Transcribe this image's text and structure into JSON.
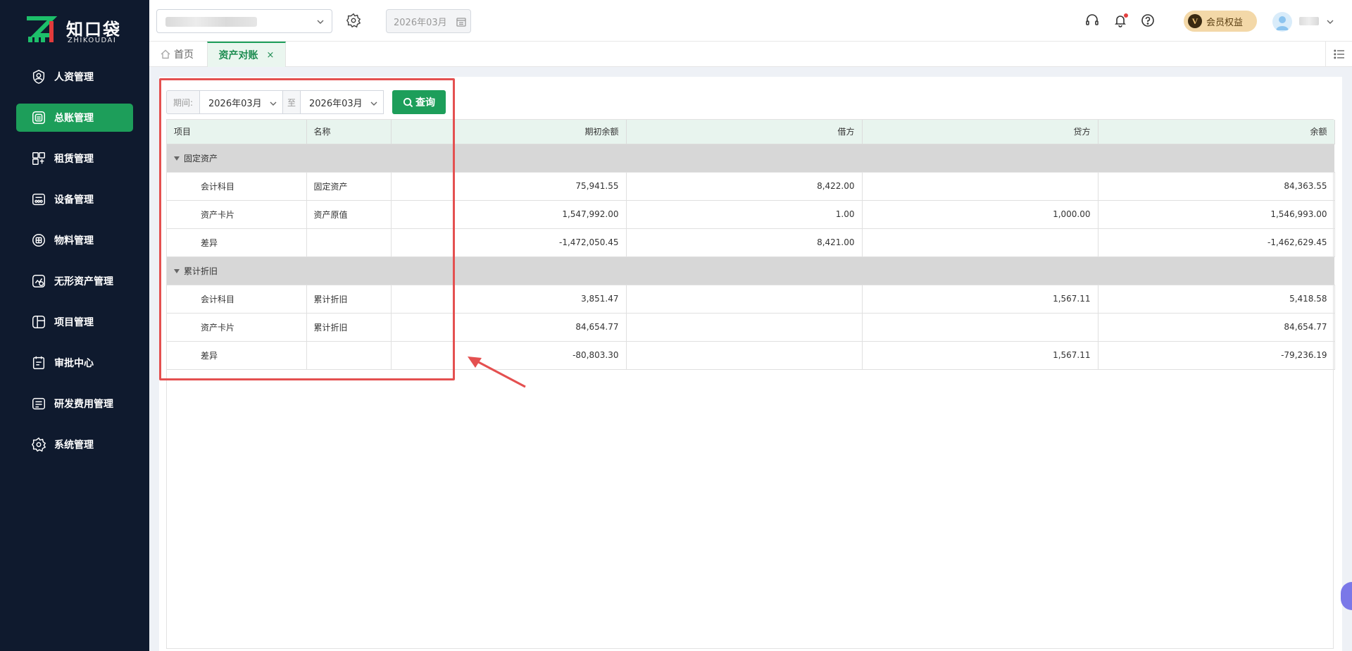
{
  "app": {
    "logo_text": "知口袋",
    "logo_sub": "ZHIKOUDAI"
  },
  "sidebar": {
    "items": [
      {
        "label": "人资管理",
        "icon": "user-shield-icon",
        "active": false
      },
      {
        "label": "总账管理",
        "icon": "ledger-icon",
        "active": true
      },
      {
        "label": "租赁管理",
        "icon": "lease-icon",
        "active": false
      },
      {
        "label": "设备管理",
        "icon": "device-icon",
        "active": false
      },
      {
        "label": "物料管理",
        "icon": "material-icon",
        "active": false
      },
      {
        "label": "无形资产管理",
        "icon": "intangible-asset-icon",
        "active": false
      },
      {
        "label": "项目管理",
        "icon": "project-icon",
        "active": false
      },
      {
        "label": "审批中心",
        "icon": "approval-icon",
        "active": false
      },
      {
        "label": "研发费用管理",
        "icon": "rd-expense-icon",
        "active": false
      },
      {
        "label": "系统管理",
        "icon": "settings-icon",
        "active": false
      }
    ]
  },
  "header": {
    "period": "2026年03月",
    "member_label": "会员权益",
    "member_badge_letter": "V"
  },
  "tabs": {
    "home": "首页",
    "active": "资产对账",
    "close": "×"
  },
  "toolbar": {
    "period_label": "期间:",
    "start": "2026年03月",
    "to_label": "至",
    "end": "2026年03月",
    "query_label": "查询"
  },
  "table": {
    "columns": [
      "项目",
      "名称",
      "",
      "期初余额",
      "借方",
      "贷方",
      "余额"
    ],
    "groups": [
      {
        "title": "固定资产",
        "rows": [
          {
            "item": "会计科目",
            "name": "固定资产",
            "extra": "",
            "opening": "75,941.55",
            "debit": "8,422.00",
            "credit": "",
            "balance": "84,363.55"
          },
          {
            "item": "资产卡片",
            "name": "资产原值",
            "extra": "",
            "opening": "1,547,992.00",
            "debit": "1.00",
            "credit": "1,000.00",
            "balance": "1,546,993.00"
          },
          {
            "item": "差异",
            "name": "",
            "extra": "",
            "opening": "-1,472,050.45",
            "debit": "8,421.00",
            "credit": "",
            "balance": "-1,462,629.45"
          }
        ]
      },
      {
        "title": "累计折旧",
        "rows": [
          {
            "item": "会计科目",
            "name": "累计折旧",
            "extra": "",
            "opening": "3,851.47",
            "debit": "",
            "credit": "1,567.11",
            "balance": "5,418.58"
          },
          {
            "item": "资产卡片",
            "name": "累计折旧",
            "extra": "",
            "opening": "84,654.77",
            "debit": "",
            "credit": "",
            "balance": "84,654.77"
          },
          {
            "item": "差异",
            "name": "",
            "extra": "",
            "opening": "-80,803.30",
            "debit": "",
            "credit": "1,567.11",
            "balance": "-79,236.19"
          }
        ]
      }
    ]
  },
  "colors": {
    "sidebar_bg": "#0f1a2e",
    "accent_green": "#1d9e5a",
    "annotation_red": "#e45050"
  }
}
